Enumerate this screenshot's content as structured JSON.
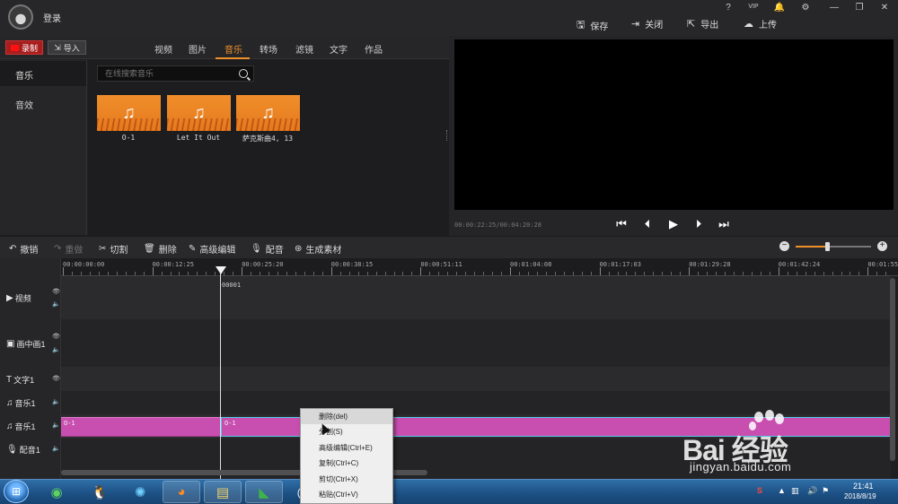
{
  "titlebar": {
    "login_label": "登录",
    "window_controls": [
      "?",
      "VIP",
      "🔔",
      "⚙",
      "—",
      "❐",
      "✕"
    ],
    "buttons": [
      {
        "label": "保存",
        "icon": "save-icon"
      },
      {
        "label": "关闭",
        "icon": "close-icon"
      },
      {
        "label": "导出",
        "icon": "export-icon"
      },
      {
        "label": "上传",
        "icon": "upload-icon"
      }
    ]
  },
  "toolrow": {
    "record_label": "录制",
    "import_label": "导入",
    "tabs": [
      "视频",
      "图片",
      "音乐",
      "转场",
      "滤镜",
      "文字",
      "作品"
    ],
    "active_tab": "音乐"
  },
  "sidebar": {
    "items": [
      "音乐",
      "音效"
    ]
  },
  "library": {
    "search_placeholder": "在线搜索音乐",
    "clips": [
      "O-1",
      "Let It Out",
      "萨克斯曲4, 13"
    ]
  },
  "preview": {
    "timecode": "00:00:22:25/00:04:20:28"
  },
  "edit_toolbar": {
    "tools": [
      {
        "label": "撤销",
        "icon": "undo-icon",
        "enabled": true
      },
      {
        "label": "重做",
        "icon": "redo-icon",
        "enabled": false
      },
      {
        "label": "切割",
        "icon": "scissors-icon",
        "enabled": true
      },
      {
        "label": "删除",
        "icon": "trash-icon",
        "enabled": true
      },
      {
        "label": "高级编辑",
        "icon": "pen-icon",
        "enabled": true
      },
      {
        "label": "配音",
        "icon": "mic-icon",
        "enabled": true
      },
      {
        "label": "生成素材",
        "icon": "film-icon",
        "enabled": true
      }
    ],
    "zoom_level": 0.42
  },
  "ruler": {
    "ticks": [
      "00:00:00:00",
      "00:00:12:25",
      "00:00:25:20",
      "00:00:38:15",
      "00:00:51:11",
      "00:01:04:08",
      "00:01:17:03",
      "00:01:29:28",
      "00:01:42:24",
      "00:01:55"
    ]
  },
  "tracks": [
    {
      "label": "视频",
      "icon": "video-track-icon"
    },
    {
      "label": "画中画1",
      "icon": "pip-track-icon"
    },
    {
      "label": "文字1",
      "icon": "text-track-icon"
    },
    {
      "label": "音乐1",
      "icon": "music-track-icon"
    },
    {
      "label": "音乐1",
      "icon": "music-track-icon"
    },
    {
      "label": "配音1",
      "icon": "mic-track-icon"
    }
  ],
  "timeline": {
    "clip_marker": "00001",
    "music_clip_a": "O-1",
    "music_clip_b": "O-1"
  },
  "context_menu": {
    "items": [
      "删除(del)",
      "分割(S)",
      "高级编辑(Ctrl+E)",
      "复制(Ctrl+C)",
      "剪切(Ctrl+X)",
      "粘贴(Ctrl+V)"
    ]
  },
  "taskbar": {
    "time": "21:41",
    "date": "2018/8/19"
  },
  "watermark": {
    "text": "Bai 经验",
    "url": "jingyan.baidu.com"
  },
  "colors": {
    "accent": "#f0902a",
    "clip": "#c84fb0",
    "selection": "#54c6e6",
    "record": "#a81e1e"
  }
}
